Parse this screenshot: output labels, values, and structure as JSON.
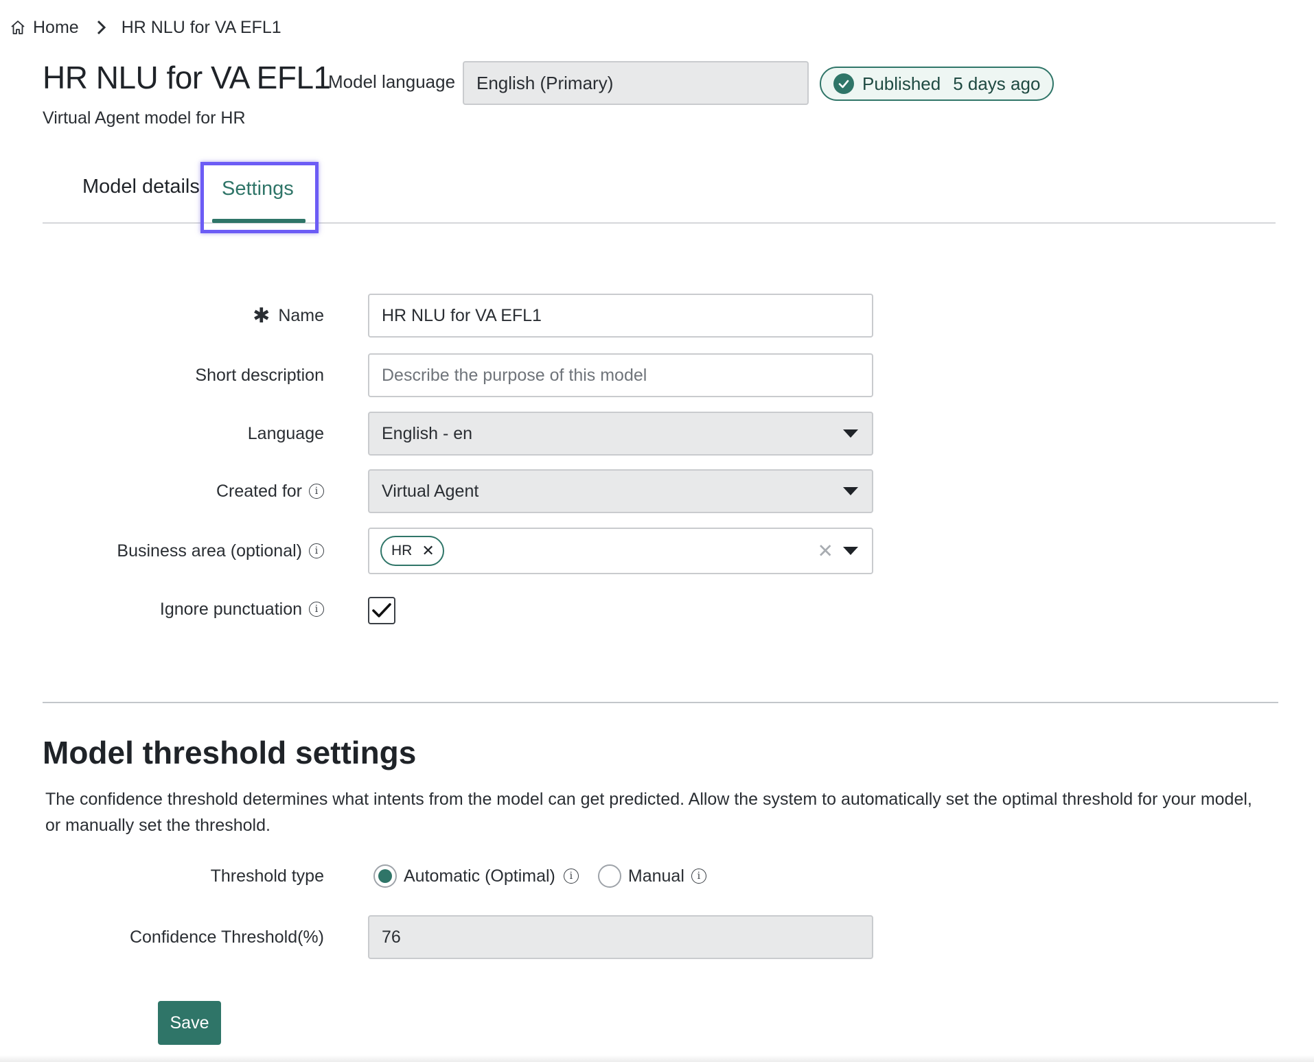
{
  "breadcrumb": {
    "home_label": "Home",
    "current": "HR NLU for VA EFL1"
  },
  "header": {
    "title": "HR NLU for VA EFL1",
    "subtitle": "Virtual Agent model for HR",
    "model_language_label": "Model language",
    "model_language_value": "English (Primary)",
    "status": "Published",
    "status_time": "5 days ago"
  },
  "tabs": [
    {
      "label": "Model details",
      "active": false
    },
    {
      "label": "Settings",
      "active": true
    }
  ],
  "form": {
    "name_label": "Name",
    "name_value": "HR NLU for VA EFL1",
    "short_description_label": "Short description",
    "short_description_placeholder": "Describe the purpose of this model",
    "language_label": "Language",
    "language_value": "English - en",
    "created_for_label": "Created for",
    "created_for_value": "Virtual Agent",
    "business_area_label": "Business area (optional)",
    "business_area_chips": [
      "HR"
    ],
    "ignore_punctuation_label": "Ignore punctuation",
    "ignore_punctuation_checked": true
  },
  "threshold": {
    "section_title": "Model threshold settings",
    "description": "The confidence threshold determines what intents from the model can get predicted. Allow the system to automatically set the optimal threshold for your model, or manually set the threshold.",
    "threshold_type_label": "Threshold type",
    "option_automatic": "Automatic (Optimal)",
    "option_manual": "Manual",
    "selected": "Automatic (Optimal)",
    "confidence_label": "Confidence Threshold(%)",
    "confidence_value": "76"
  },
  "actions": {
    "save_label": "Save"
  },
  "colors": {
    "accent": "#2f7568",
    "highlight": "#6c5cf5"
  }
}
